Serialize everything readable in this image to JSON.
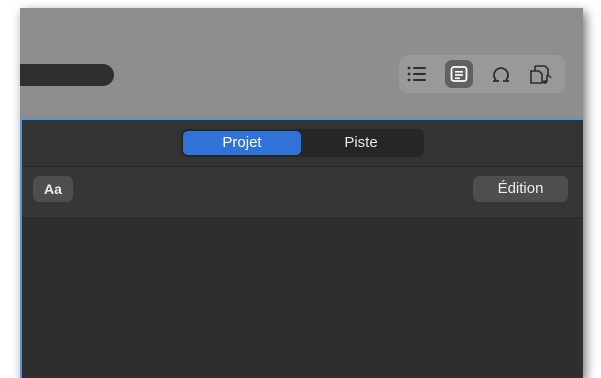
{
  "segmented": {
    "options": [
      "Projet",
      "Piste"
    ],
    "selected": "Projet"
  },
  "edit_row": {
    "format_button": "Aa",
    "edit_button": "Édition"
  },
  "view_buttons": [
    "list-icon",
    "notes-icon",
    "loop-icon",
    "score-icon"
  ],
  "colors": {
    "accent": "#2f73d8",
    "focus_border": "#5a93d8",
    "toolbar_bg": "#8e8e8e",
    "panel_bg": "#2e2e2e"
  }
}
